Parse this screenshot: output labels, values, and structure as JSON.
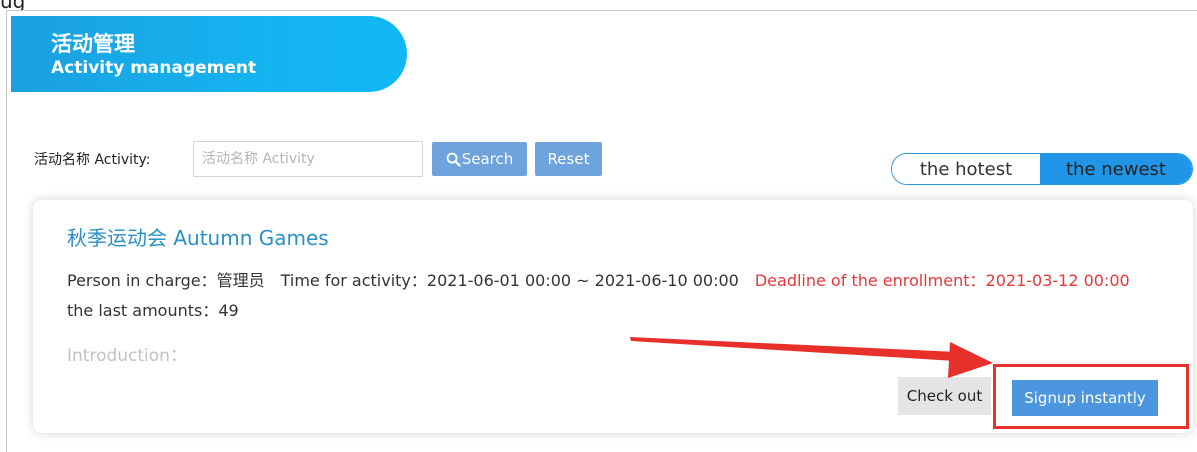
{
  "caption": "ug",
  "banner": {
    "title_cn": "活动管理",
    "title_en": "Activity management"
  },
  "search": {
    "label": "活动名称 Activity:",
    "placeholder": "活动名称 Activity",
    "value": "",
    "search_label": "Search",
    "reset_label": "Reset"
  },
  "sort_toggle": {
    "options": [
      "the hotest",
      "the newest"
    ],
    "selected": "the newest",
    "accent_color": "#2196e8"
  },
  "activity": {
    "title": "秋季运动会 Autumn Games",
    "person_label": "Person in charge：",
    "person_value": "管理员",
    "time_label": "Time for activity：",
    "time_value": "2021-06-01 00:00 ~ 2021-06-10 00:00",
    "deadline_label": "Deadline of the enrollment：",
    "deadline_value": "2021-03-12 00:00",
    "amount_label": "the last amounts：",
    "amount_value": "49",
    "intro_label": "Introduction：",
    "check_out_label": "Check out",
    "signup_label": "Signup instantly"
  },
  "annotation": {
    "color": "#e8302b",
    "icon": "red-arrow-icon"
  }
}
